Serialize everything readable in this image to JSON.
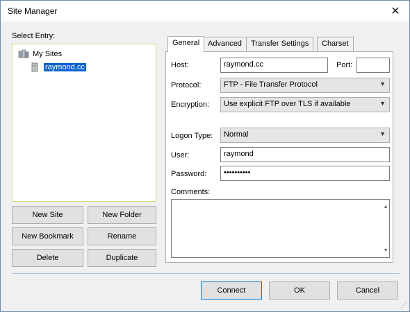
{
  "window": {
    "title": "Site Manager"
  },
  "left": {
    "select_entry_label": "Select Entry:",
    "tree": {
      "root_label": "My Sites",
      "child_label": "raymond.cc"
    },
    "buttons": {
      "new_site": "New Site",
      "new_folder": "New Folder",
      "new_bookmark": "New Bookmark",
      "rename": "Rename",
      "delete": "Delete",
      "duplicate": "Duplicate"
    }
  },
  "tabs": [
    "General",
    "Advanced",
    "Transfer Settings",
    "Charset"
  ],
  "general": {
    "host_label": "Host:",
    "host_value": "raymond.cc",
    "port_label": "Port:",
    "port_value": "",
    "protocol_label": "Protocol:",
    "protocol_value": "FTP - File Transfer Protocol",
    "encryption_label": "Encryption:",
    "encryption_value": "Use explicit FTP over TLS if available",
    "logon_type_label": "Logon Type:",
    "logon_type_value": "Normal",
    "user_label": "User:",
    "user_value": "raymond",
    "password_label": "Password:",
    "password_value": "••••••••••",
    "comments_label": "Comments:"
  },
  "footer": {
    "connect": "Connect",
    "ok": "OK",
    "cancel": "Cancel"
  }
}
